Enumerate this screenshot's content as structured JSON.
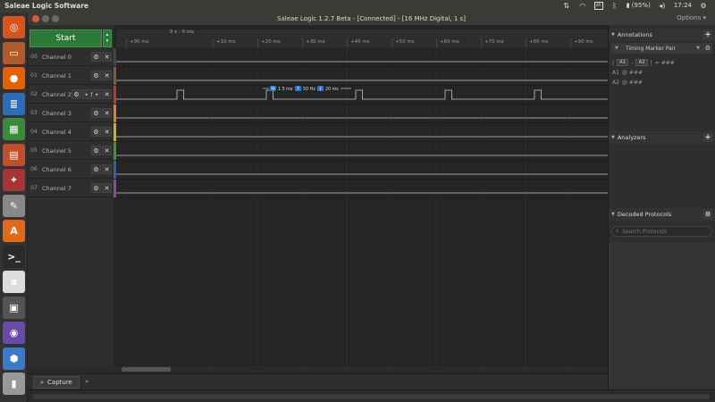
{
  "topbar": {
    "app_name": "Saleae Logic Software",
    "keyboard": "zh",
    "battery": "(95%)",
    "clock": "17:24"
  },
  "window": {
    "title": "Saleae Logic 1.2.7 Beta - [Connected] - [16 MHz Digital, 1 s]",
    "options_label": "Options ▾"
  },
  "launcher": {
    "items": [
      {
        "name": "ubuntu-dash-icon",
        "color": "#d9531e",
        "glyph": "◎"
      },
      {
        "name": "files-icon",
        "color": "#b35a2a",
        "glyph": "▭"
      },
      {
        "name": "firefox-icon",
        "color": "#e66000",
        "glyph": "●"
      },
      {
        "name": "writer-icon",
        "color": "#2a6ebb",
        "glyph": "≣"
      },
      {
        "name": "calc-icon",
        "color": "#3a8a3a",
        "glyph": "▦"
      },
      {
        "name": "impress-icon",
        "color": "#c0502a",
        "glyph": "▤"
      },
      {
        "name": "settings-icon",
        "color": "#aa3333",
        "glyph": "✦"
      },
      {
        "name": "editor-icon",
        "color": "#888888",
        "glyph": "✎"
      },
      {
        "name": "software-center-icon",
        "color": "#e06a1a",
        "glyph": "A"
      },
      {
        "name": "terminal-icon",
        "color": "#2a2a2a",
        "glyph": ">_"
      },
      {
        "name": "amazon-icon",
        "color": "#dddddd",
        "glyph": "a"
      },
      {
        "name": "logic-analyzer-icon",
        "color": "#555555",
        "glyph": "▣"
      },
      {
        "name": "purple-app-icon",
        "color": "#6a4aa8",
        "glyph": "◉"
      },
      {
        "name": "virtualbox-icon",
        "color": "#3a7acc",
        "glyph": "⬢"
      },
      {
        "name": "usb-icon",
        "color": "#999999",
        "glyph": "▮"
      }
    ]
  },
  "capture": {
    "start_label": "Start",
    "time_origin": "0 s : 0 ms",
    "ticks": [
      "+90 ms",
      "+10 ms",
      "+20 ms",
      "+30 ms",
      "+40 ms",
      "+50 ms",
      "+60 ms",
      "+70 ms",
      "+80 ms",
      "+90 ms"
    ],
    "measure": {
      "width": "1.5 ms",
      "freq": "50 Hz",
      "period": "20 ms",
      "w_tag": "W",
      "f_tag": "f",
      "t_tag": "t"
    },
    "channels": [
      {
        "num": "00",
        "name": "Channel 0",
        "color": "#444444"
      },
      {
        "num": "01",
        "name": "Channel 1",
        "color": "#8a5a2a"
      },
      {
        "num": "02",
        "name": "Channel 2",
        "color": "#c0392b"
      },
      {
        "num": "03",
        "name": "Channel 3",
        "color": "#e67e22"
      },
      {
        "num": "04",
        "name": "Channel 4",
        "color": "#d4b106"
      },
      {
        "num": "05",
        "name": "Channel 5",
        "color": "#3a9a3a"
      },
      {
        "num": "06",
        "name": "Channel 6",
        "color": "#2a5fc0"
      },
      {
        "num": "07",
        "name": "Channel 7",
        "color": "#8e44ad"
      }
    ],
    "nav_labels": {
      "prev": "◂",
      "mid": "ƒ",
      "next": "▸"
    }
  },
  "tabs": {
    "capture": "Capture",
    "more": "»"
  },
  "annotations": {
    "title": "Annotations",
    "marker": "Timing Marker Pair",
    "row1": {
      "a": "A1",
      "b": "A2",
      "eq": "= ###",
      "sep": "|"
    },
    "row2": {
      "label": "A1",
      "val": "@ ###"
    },
    "row3": {
      "label": "A2",
      "val": "@ ###"
    }
  },
  "analyzers": {
    "title": "Analyzers"
  },
  "decoded": {
    "title": "Decoded Protocols",
    "search_placeholder": "Search Protocols"
  }
}
